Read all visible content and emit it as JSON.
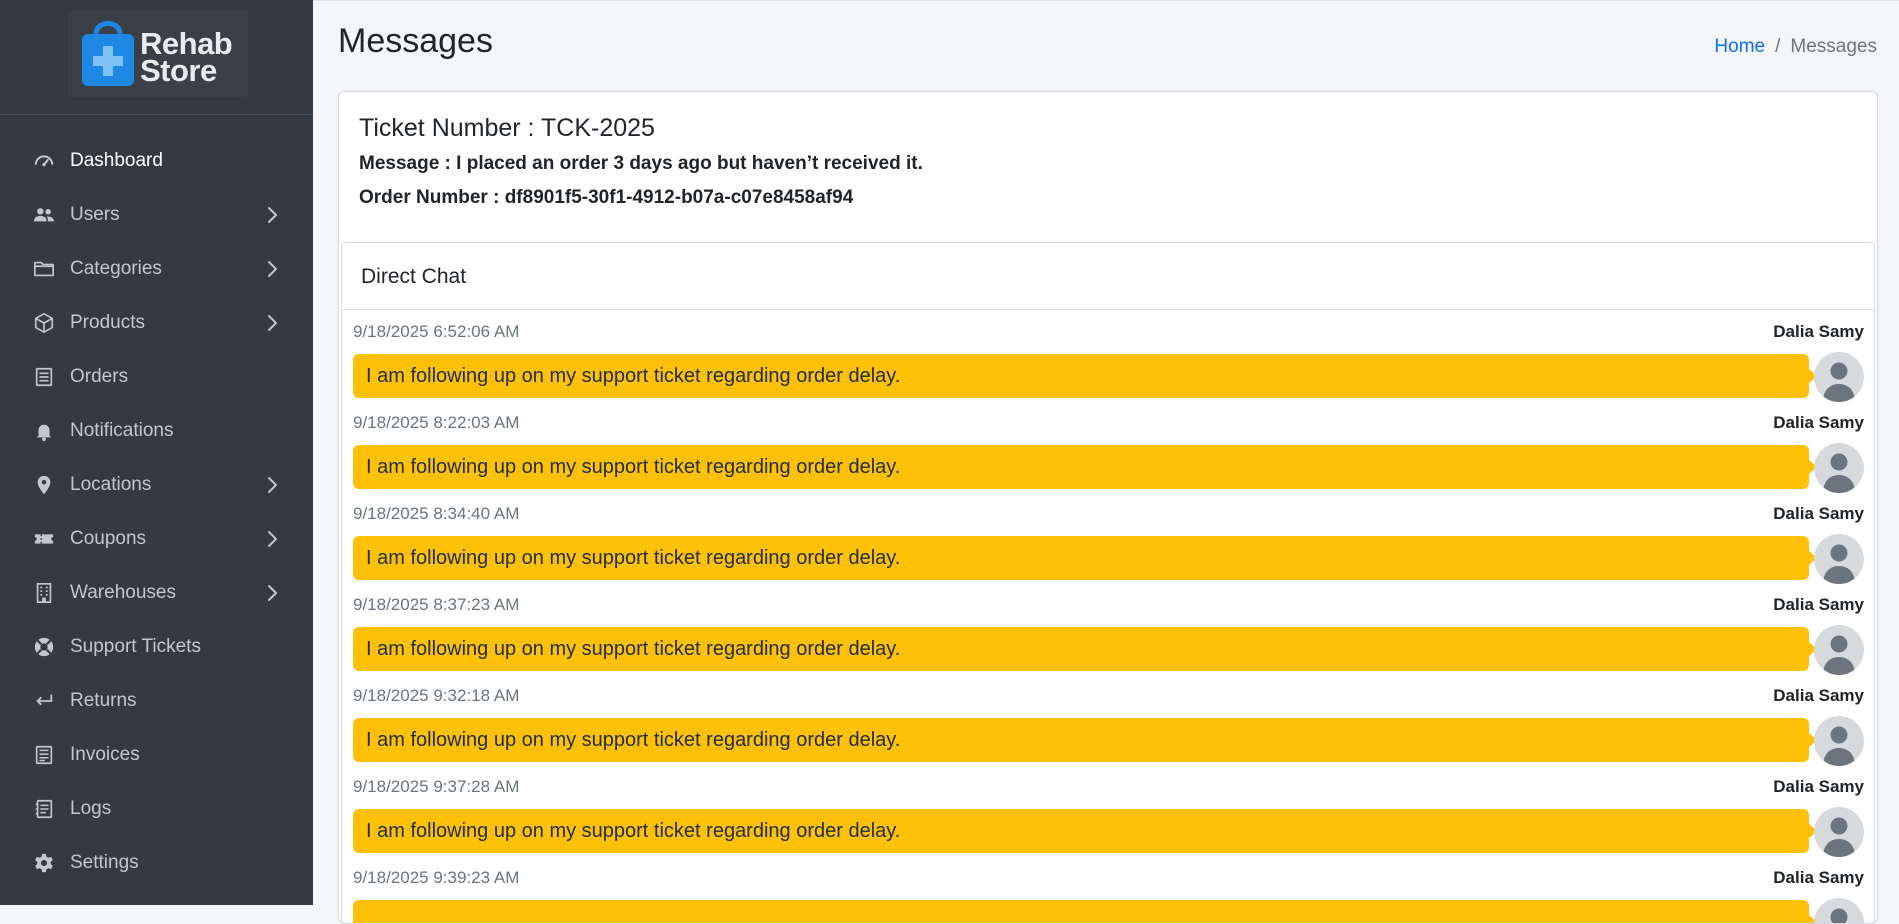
{
  "brand": {
    "line1": "Rehab",
    "line2": "Store",
    "icon": "shopping-bag-plus-icon"
  },
  "sidebar": {
    "items": [
      {
        "label": "Dashboard",
        "icon": "tachometer-icon",
        "active": true,
        "has_children": false
      },
      {
        "label": "Users",
        "icon": "users-icon",
        "has_children": true
      },
      {
        "label": "Categories",
        "icon": "folder-icon",
        "has_children": true
      },
      {
        "label": "Products",
        "icon": "box-icon",
        "has_children": true
      },
      {
        "label": "Orders",
        "icon": "receipt-icon",
        "has_children": false
      },
      {
        "label": "Notifications",
        "icon": "bell-icon",
        "has_children": false
      },
      {
        "label": "Locations",
        "icon": "map-pin-icon",
        "has_children": true
      },
      {
        "label": "Coupons",
        "icon": "ticket-icon",
        "has_children": true
      },
      {
        "label": "Warehouses",
        "icon": "building-icon",
        "has_children": true
      },
      {
        "label": "Support Tickets",
        "icon": "life-ring-icon",
        "has_children": false
      },
      {
        "label": "Returns",
        "icon": "return-arrow-icon",
        "has_children": false
      },
      {
        "label": "Invoices",
        "icon": "invoice-icon",
        "has_children": false
      },
      {
        "label": "Logs",
        "icon": "log-icon",
        "has_children": false
      },
      {
        "label": "Settings",
        "icon": "gear-icon",
        "has_children": false
      }
    ]
  },
  "page": {
    "title": "Messages"
  },
  "breadcrumb": {
    "home": "Home",
    "separator": "/",
    "current": "Messages"
  },
  "ticket": {
    "number_label": "Ticket Number : TCK-2025",
    "message_label": "Message : I placed an order 3 days ago but haven’t received it.",
    "order_label": "Order Number : df8901f5-30f1-4912-b07a-c07e8458af94"
  },
  "chat": {
    "title": "Direct Chat",
    "messages": [
      {
        "time": "9/18/2025 6:52:06 AM",
        "name": "Dalia Samy",
        "text": "I am following up on my support ticket regarding order delay."
      },
      {
        "time": "9/18/2025 8:22:03 AM",
        "name": "Dalia Samy",
        "text": "I am following up on my support ticket regarding order delay."
      },
      {
        "time": "9/18/2025 8:34:40 AM",
        "name": "Dalia Samy",
        "text": "I am following up on my support ticket regarding order delay."
      },
      {
        "time": "9/18/2025 8:37:23 AM",
        "name": "Dalia Samy",
        "text": "I am following up on my support ticket regarding order delay."
      },
      {
        "time": "9/18/2025 9:32:18 AM",
        "name": "Dalia Samy",
        "text": "I am following up on my support ticket regarding order delay."
      },
      {
        "time": "9/18/2025 9:37:28 AM",
        "name": "Dalia Samy",
        "text": "I am following up on my support ticket regarding order delay."
      },
      {
        "time": "9/18/2025 9:39:23 AM",
        "name": "Dalia Samy",
        "text": ""
      }
    ]
  },
  "colors": {
    "sidebar_bg": "#343a40",
    "bubble": "#ffc107",
    "link": "#0d6efd",
    "brand_blue": "#1e88e5"
  }
}
